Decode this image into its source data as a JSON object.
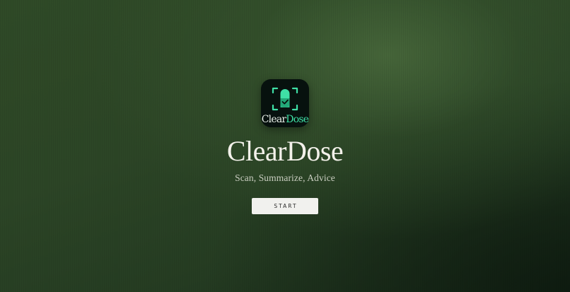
{
  "app": {
    "icon_label_part1": "Clear",
    "icon_label_part2": "Dose",
    "title": "ClearDose",
    "tagline": "Scan, Summarize, Advice"
  },
  "actions": {
    "start_label": "START"
  },
  "icons": {
    "app_icon": "pill-scan-icon"
  },
  "colors": {
    "accent": "#3fe0a6",
    "background": "#2c4526",
    "button_bg": "#f1f1ee"
  }
}
